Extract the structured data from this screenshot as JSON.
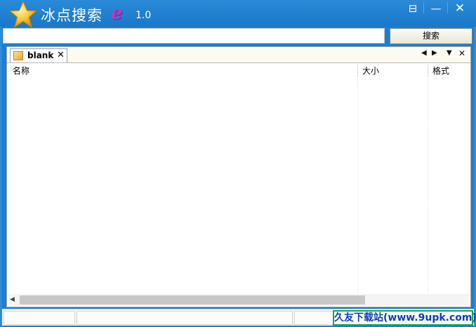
{
  "window": {
    "title": "冰点搜索",
    "version": "1.0",
    "logo_letter": "e",
    "controls": {
      "restore": "⊟",
      "minimize": "—",
      "close": "✕"
    }
  },
  "search": {
    "value": "",
    "placeholder": "",
    "button_label": "搜索"
  },
  "tabs": [
    {
      "label": "blank",
      "icon": "document-icon",
      "close": "✕"
    }
  ],
  "tabstrip_controls": {
    "prev": "◀",
    "next": "▶",
    "menu": "▼",
    "close": "✕"
  },
  "columns": [
    "名称",
    "大小",
    "格式"
  ],
  "rows": [],
  "watermark": "久友下载站(www.9upk.com)",
  "colors": {
    "titlebar": "#1a78c8",
    "accent_star": "#f7b21e",
    "logo": "#b23ec3",
    "watermark_border": "#1aa24a",
    "watermark_text": "#0a3fb6"
  }
}
